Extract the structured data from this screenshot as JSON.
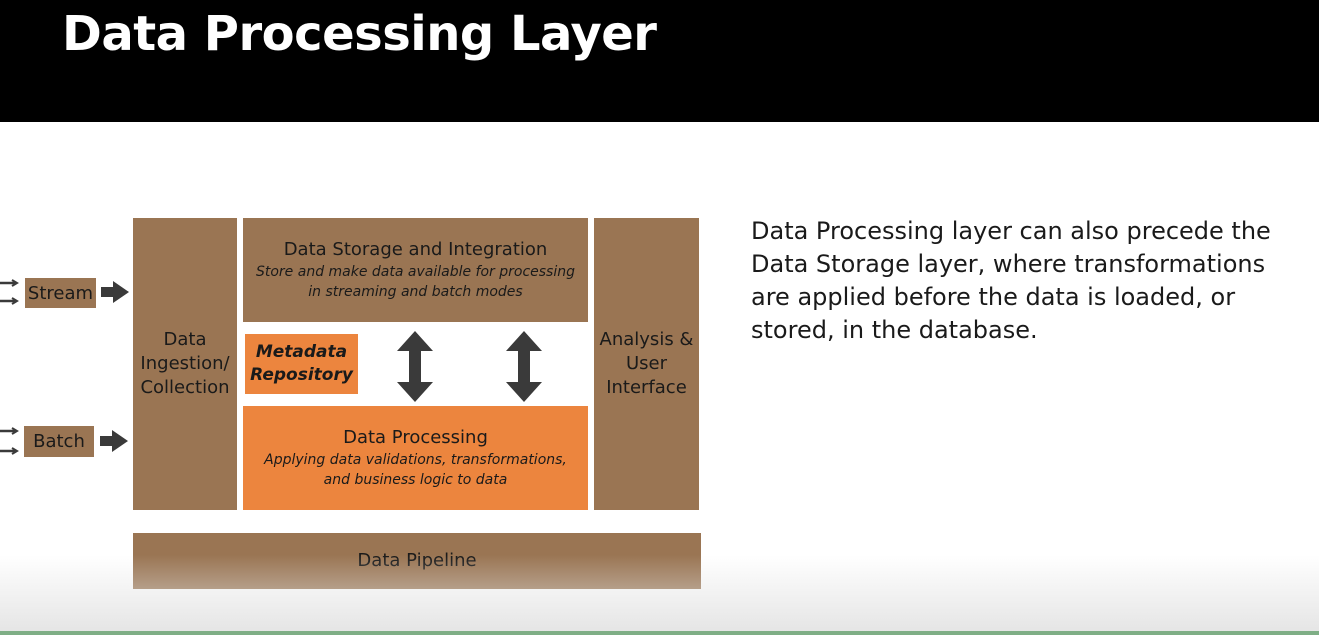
{
  "header": {
    "title": "Data Processing Layer"
  },
  "diagram": {
    "sources": [
      {
        "label": "Stream"
      },
      {
        "label": "Batch"
      }
    ],
    "ingestion": {
      "label": "Data\nIngestion/\nCollection"
    },
    "storage": {
      "label": "Data Storage and Integration",
      "sublabel": "Store and make data available for processing\nin streaming and batch modes"
    },
    "metadata": {
      "label": "Metadata\nRepository"
    },
    "processing": {
      "label": "Data Processing",
      "sublabel": "Applying data validations, transformations,\nand business logic to data"
    },
    "analysis": {
      "label": "Analysis &\nUser\nInterface"
    },
    "pipeline": {
      "label": "Data Pipeline"
    },
    "colors": {
      "brown": "#9a7553",
      "orange": "#ec853e",
      "arrow": "#3a3a3a"
    }
  },
  "description": "Data Processing layer can also precede the\nData Storage layer, where transformations\nare applied before the data is loaded, or\nstored, in the database."
}
